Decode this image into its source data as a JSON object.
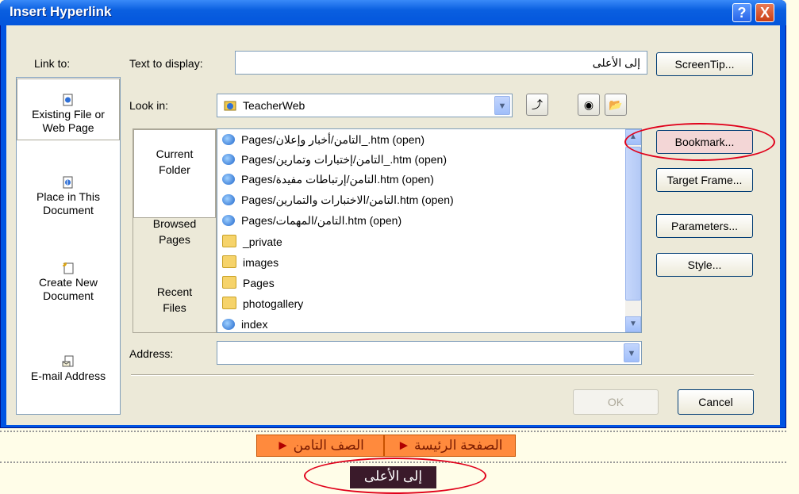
{
  "window": {
    "title": "Insert Hyperlink",
    "help_glyph": "?",
    "close_glyph": "X"
  },
  "link_to": {
    "label": "Link to:",
    "items": [
      {
        "line1": "Existing File or",
        "line2": "Web Page"
      },
      {
        "line1": "Place in This",
        "line2": "Document"
      },
      {
        "line1": "Create New",
        "line2": "Document"
      },
      {
        "line1": "E-mail Address",
        "line2": ""
      }
    ]
  },
  "text_to_display": {
    "label": "Text to display:",
    "value": "إلى الأعلى"
  },
  "look_in": {
    "label": "Look in:",
    "value": "TeacherWeb"
  },
  "folder_tabs": [
    {
      "line1": "Current",
      "line2": "Folder"
    },
    {
      "line1": "Browsed",
      "line2": "Pages"
    },
    {
      "line1": "Recent",
      "line2": "Files"
    }
  ],
  "files": [
    {
      "name": "Pages/التامن/أخبار وإعلان_.htm (open)",
      "type": "ie"
    },
    {
      "name": "Pages/التامن/إختبارات وتمارين_.htm (open)",
      "type": "ie"
    },
    {
      "name": "Pages/التامن/إرتباطات مفيدة.htm (open)",
      "type": "ie"
    },
    {
      "name": "Pages/التامن/الاختبارات والتمارين.htm (open)",
      "type": "ie"
    },
    {
      "name": "Pages/التامن/المهمات.htm (open)",
      "type": "ie"
    },
    {
      "name": "_private",
      "type": "folder"
    },
    {
      "name": "images",
      "type": "folder"
    },
    {
      "name": "Pages",
      "type": "folder"
    },
    {
      "name": "photogallery",
      "type": "folder"
    },
    {
      "name": "index",
      "type": "ie"
    }
  ],
  "address": {
    "label": "Address:",
    "value": ""
  },
  "buttons": {
    "screentip": "ScreenTip...",
    "bookmark": "Bookmark...",
    "target_frame": "Target Frame...",
    "parameters": "Parameters...",
    "style": "Style...",
    "ok": "OK",
    "cancel": "Cancel"
  },
  "page_nav": {
    "home": "الصفحة الرئيسة",
    "grade": "الصف التامن",
    "to_top": "إلى الأعلى"
  }
}
